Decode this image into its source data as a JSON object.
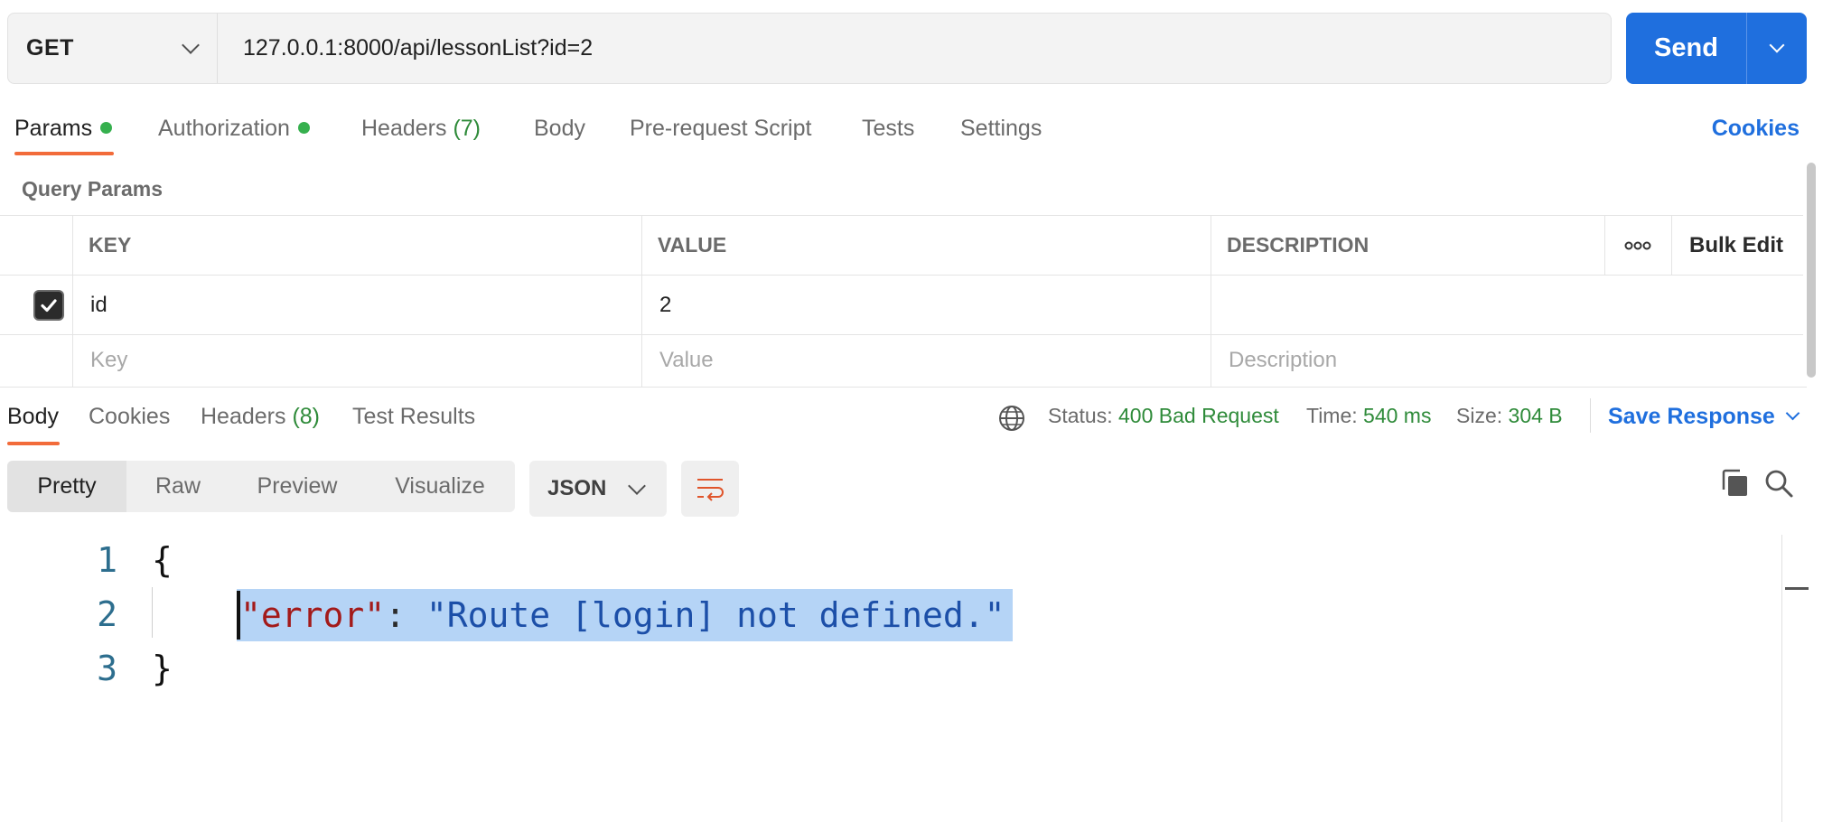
{
  "request": {
    "method": "GET",
    "url": "127.0.0.1:8000/api/lessonList?id=2",
    "send_label": "Send"
  },
  "request_tabs": [
    {
      "label": "Params",
      "active": true,
      "dot": true
    },
    {
      "label": "Authorization",
      "dot": true
    },
    {
      "label": "Headers",
      "count": "(7)"
    },
    {
      "label": "Body"
    },
    {
      "label": "Pre-request Script"
    },
    {
      "label": "Tests"
    },
    {
      "label": "Settings"
    }
  ],
  "cookies_label": "Cookies",
  "query_params": {
    "title": "Query Params",
    "headers": {
      "key": "KEY",
      "value": "VALUE",
      "description": "DESCRIPTION",
      "more": "ooo",
      "bulk_edit": "Bulk Edit"
    },
    "rows": [
      {
        "checked": true,
        "key": "id",
        "value": "2",
        "description": ""
      }
    ],
    "placeholders": {
      "key": "Key",
      "value": "Value",
      "description": "Description"
    }
  },
  "response_tabs": [
    {
      "label": "Body",
      "active": true
    },
    {
      "label": "Cookies"
    },
    {
      "label": "Headers",
      "count": "(8)"
    },
    {
      "label": "Test Results"
    }
  ],
  "response_meta": {
    "status_label": "Status:",
    "status_value": "400 Bad Request",
    "time_label": "Time:",
    "time_value": "540 ms",
    "size_label": "Size:",
    "size_value": "304 B",
    "save_label": "Save Response"
  },
  "view_modes": [
    "Pretty",
    "Raw",
    "Preview",
    "Visualize"
  ],
  "format": "JSON",
  "code": {
    "line_numbers": [
      "1",
      "2",
      "3"
    ],
    "open_brace": "{",
    "close_brace": "}",
    "key": "\"error\"",
    "colon": ": ",
    "value": "\"Route [login] not defined.\""
  },
  "colors": {
    "accent": "#1f6fde",
    "tab_underline": "#f26b3a",
    "status_green": "#2f8b3a",
    "selection": "#b5d4f6"
  },
  "icons": [
    "chevron-down-icon",
    "check-icon",
    "globe-icon",
    "wrap-lines-icon",
    "copy-icon",
    "search-icon"
  ]
}
